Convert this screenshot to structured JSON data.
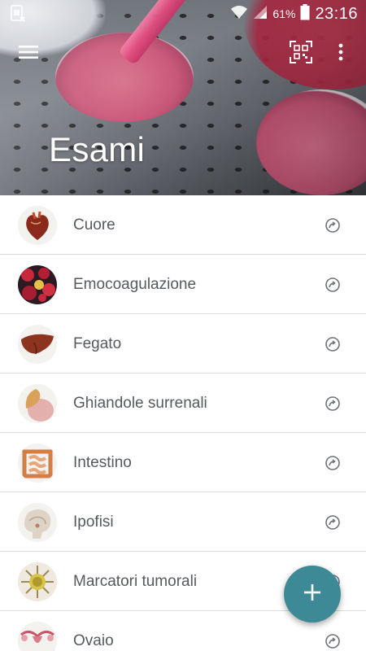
{
  "status_bar": {
    "notification_icon": "sim-notification-icon",
    "battery_percent": "61%",
    "time": "23:16",
    "icons": [
      "wifi-icon",
      "signal-icon",
      "battery-icon"
    ]
  },
  "toolbar": {
    "menu_icon": "hamburger-menu-icon",
    "qr_icon": "qr-scan-icon",
    "more_icon": "more-vert-icon"
  },
  "header": {
    "title": "Esami"
  },
  "exams": [
    {
      "label": "Cuore",
      "icon": "heart-thumbnail"
    },
    {
      "label": "Emocoagulazione",
      "icon": "blood-cells-thumbnail"
    },
    {
      "label": "Fegato",
      "icon": "liver-thumbnail"
    },
    {
      "label": "Ghiandole surrenali",
      "icon": "adrenal-gland-thumbnail"
    },
    {
      "label": "Intestino",
      "icon": "intestine-thumbnail"
    },
    {
      "label": "Ipofisi",
      "icon": "pituitary-thumbnail"
    },
    {
      "label": "Marcatori tumorali",
      "icon": "tumor-marker-thumbnail"
    },
    {
      "label": "Ovaio",
      "icon": "ovary-thumbnail"
    }
  ],
  "fab": {
    "icon": "plus-icon",
    "color": "#3d8a96"
  },
  "colors": {
    "list_text": "#555a5e",
    "divider": "#dcdcdc",
    "accent": "#3d8a96"
  }
}
